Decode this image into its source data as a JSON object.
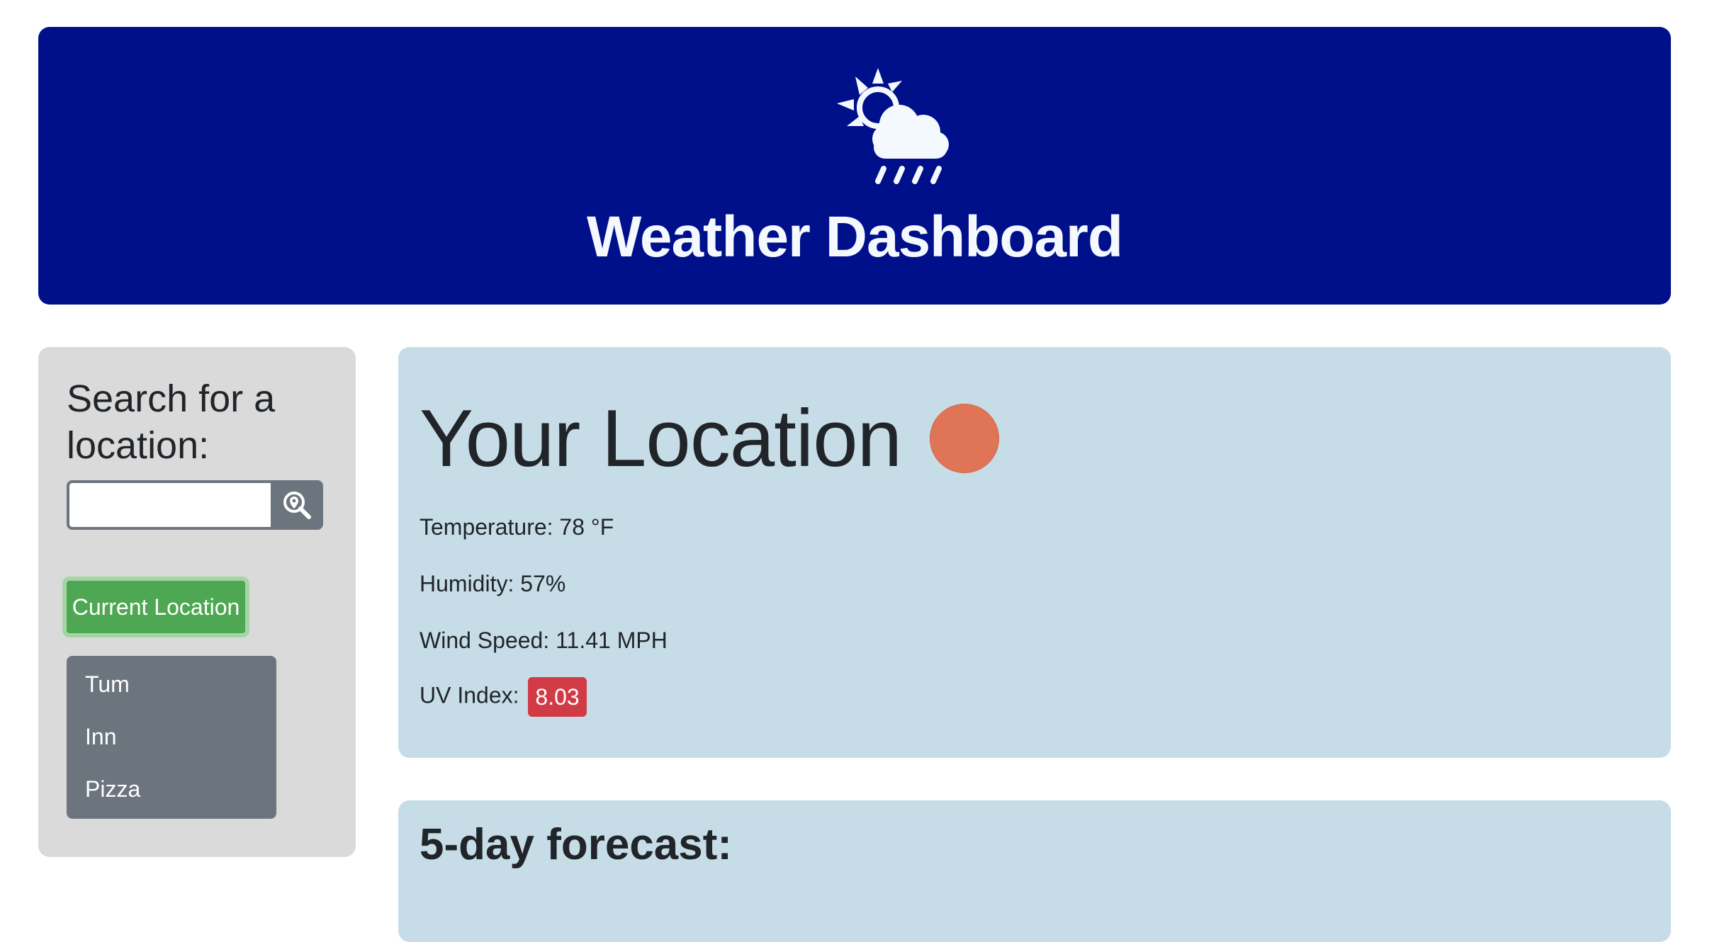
{
  "header": {
    "title": "Weather Dashboard",
    "icon": "sun-cloud-rain-icon",
    "background_color": "#000f8a"
  },
  "sidebar": {
    "heading": "Search for a location:",
    "search": {
      "value": "",
      "placeholder": "",
      "button_icon": "location-search-icon"
    },
    "current_location_label": "Current Location",
    "history": [
      {
        "label": "Tum"
      },
      {
        "label": "Inn"
      },
      {
        "label": "Pizza"
      }
    ]
  },
  "current": {
    "title": "Your Location",
    "icon": "weather-circle-icon",
    "icon_color": "#e07457",
    "temperature": "Temperature: 78 °F",
    "humidity": "Humidity: 57%",
    "wind": "Wind Speed: 11.41 MPH",
    "uv_label": "UV Index:",
    "uv_value": "8.03",
    "uv_color": "#d13b45"
  },
  "forecast": {
    "title": "5-day forecast:"
  }
}
